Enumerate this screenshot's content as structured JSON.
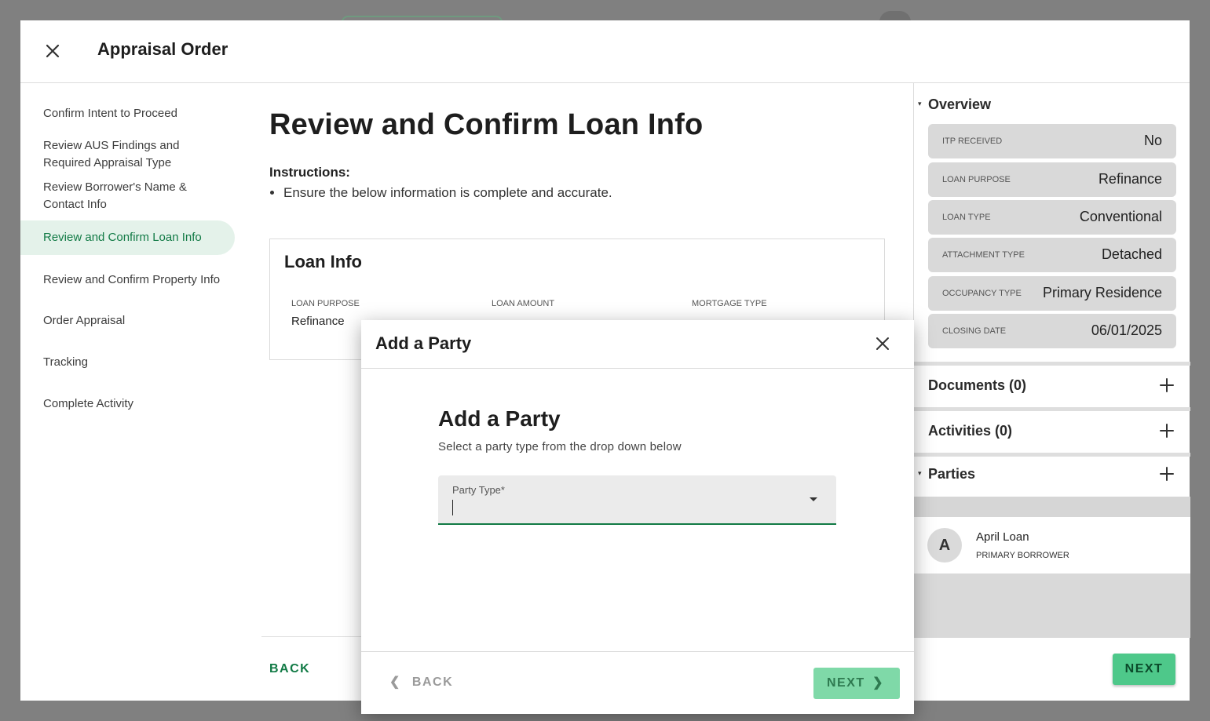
{
  "modal": {
    "title": "Appraisal Order"
  },
  "nav": {
    "items": [
      {
        "label": "Confirm Intent to Proceed"
      },
      {
        "label": "Review AUS Findings and Required Appraisal Type"
      },
      {
        "label": "Review Borrower's Name & Contact Info"
      },
      {
        "label": "Review and Confirm Loan Info",
        "active": true
      },
      {
        "label": "Review and Confirm Property Info"
      },
      {
        "label": "Order Appraisal"
      },
      {
        "label": "Tracking"
      },
      {
        "label": "Complete Activity"
      }
    ]
  },
  "main": {
    "title": "Review and Confirm Loan Info",
    "instructions_label": "Instructions:",
    "instructions": [
      "Ensure the below information is complete and accurate."
    ],
    "card": {
      "title": "Loan Info",
      "fields": [
        {
          "label": "LOAN PURPOSE",
          "value": "Refinance"
        },
        {
          "label": "LOAN AMOUNT",
          "value": ""
        },
        {
          "label": "MORTGAGE TYPE",
          "value": ""
        }
      ]
    },
    "back_label": "BACK"
  },
  "overview": {
    "title": "Overview",
    "rows": [
      {
        "label": "ITP RECEIVED",
        "value": "No"
      },
      {
        "label": "LOAN PURPOSE",
        "value": "Refinance"
      },
      {
        "label": "LOAN TYPE",
        "value": "Conventional"
      },
      {
        "label": "ATTACHMENT TYPE",
        "value": "Detached"
      },
      {
        "label": "OCCUPANCY TYPE",
        "value": "Primary Residence"
      },
      {
        "label": "CLOSING DATE",
        "value": "06/01/2025"
      }
    ]
  },
  "documents": {
    "title": "Documents (0)"
  },
  "activities": {
    "title": "Activities (0)"
  },
  "parties": {
    "title": "Parties",
    "items": [
      {
        "initial": "A",
        "name": "April Loan",
        "role": "PRIMARY BORROWER"
      }
    ]
  },
  "footer": {
    "next_label": "NEXT"
  },
  "dialog": {
    "title": "Add a Party",
    "heading": "Add a Party",
    "subtitle": "Select a party type from the drop down below",
    "party_type_label": "Party Type*",
    "party_type_value": "",
    "back_label": "BACK",
    "next_label": "NEXT"
  },
  "colors": {
    "accent": "#117a45",
    "button_green": "#4ec88a",
    "active_nav_bg": "#e4f2ea"
  }
}
